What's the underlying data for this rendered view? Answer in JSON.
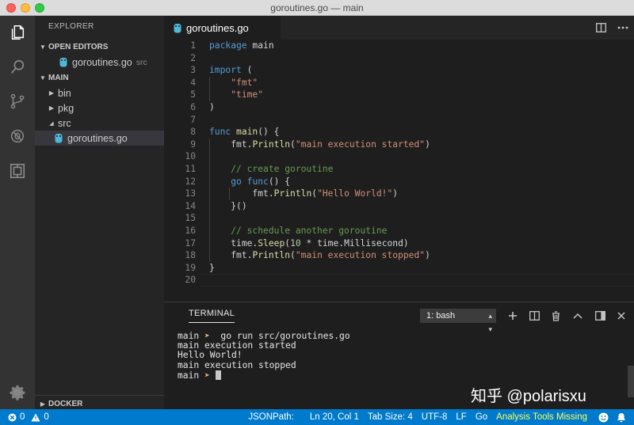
{
  "window": {
    "title": "goroutines.go — main"
  },
  "sidebar": {
    "title": "EXPLORER",
    "open_editors_label": "OPEN EDITORS",
    "open_editor_file": "goroutines.go",
    "open_editor_dir": "src",
    "main_label": "MAIN",
    "tree": [
      {
        "label": "bin",
        "type": "folder",
        "expanded": false
      },
      {
        "label": "pkg",
        "type": "folder",
        "expanded": false
      },
      {
        "label": "src",
        "type": "folder",
        "expanded": true
      },
      {
        "label": "goroutines.go",
        "type": "file"
      }
    ],
    "docker_label": "DOCKER"
  },
  "editor": {
    "tab_label": "goroutines.go",
    "line_numbers": [
      "1",
      "2",
      "3",
      "4",
      "5",
      "6",
      "7",
      "8",
      "9",
      "10",
      "11",
      "12",
      "13",
      "14",
      "15",
      "16",
      "17",
      "18",
      "19",
      "20"
    ],
    "lines": {
      "l1_kw": "package",
      "l1_rest": " main",
      "l3_kw": "import",
      "l3_rest": " (",
      "l4": "\"fmt\"",
      "l5": "\"time\"",
      "l6": ")",
      "l8_kw": "func",
      "l8_fn": "main",
      "l8_rest": "() {",
      "l9_pkg": "fmt.",
      "l9_fn": "Println",
      "l9_open": "(",
      "l9_str": "\"main execution started\"",
      "l9_close": ")",
      "l11": "// create goroutine",
      "l12_kw1": "go",
      "l12_kw2": "func",
      "l12_rest": "() {",
      "l13_pkg": "fmt.",
      "l13_fn": "Println",
      "l13_open": "(",
      "l13_str": "\"Hello World!\"",
      "l13_close": ")",
      "l14": "}()",
      "l16": "// schedule another goroutine",
      "l17_pkg": "time.",
      "l17_fn": "Sleep",
      "l17_open": "(",
      "l17_num": "10",
      "l17_rest": " * time.Millisecond)",
      "l18_pkg": "fmt.",
      "l18_fn": "Println",
      "l18_open": "(",
      "l18_str": "\"main execution stopped\"",
      "l18_close": ")",
      "l19": "}"
    }
  },
  "panel": {
    "tab_label": "TERMINAL",
    "terminal_select": "1: bash",
    "lines": {
      "t1_dir": "main",
      "t1_arrow": " ➤ ",
      "t1_cmd": " go run src/goroutines.go",
      "t2": "main execution started",
      "t3": "Hello World!",
      "t4": "main execution stopped",
      "t5_dir": "main",
      "t5_arrow": " ➤ "
    },
    "watermark": "知乎 @polarisxu"
  },
  "statusbar": {
    "errors": "0",
    "warnings": "0",
    "jsonpath": "JSONPath:",
    "position": "Ln 20, Col 1",
    "tab_size": "Tab Size: 4",
    "encoding": "UTF-8",
    "eol": "LF",
    "language": "Go",
    "analysis": "Analysis Tools Missing"
  },
  "colors": {
    "accent": "#007acc",
    "keyword": "#569cd6",
    "string": "#ce9178",
    "function": "#dcdcaa",
    "comment": "#6a9955",
    "warning": "#ffff55"
  }
}
